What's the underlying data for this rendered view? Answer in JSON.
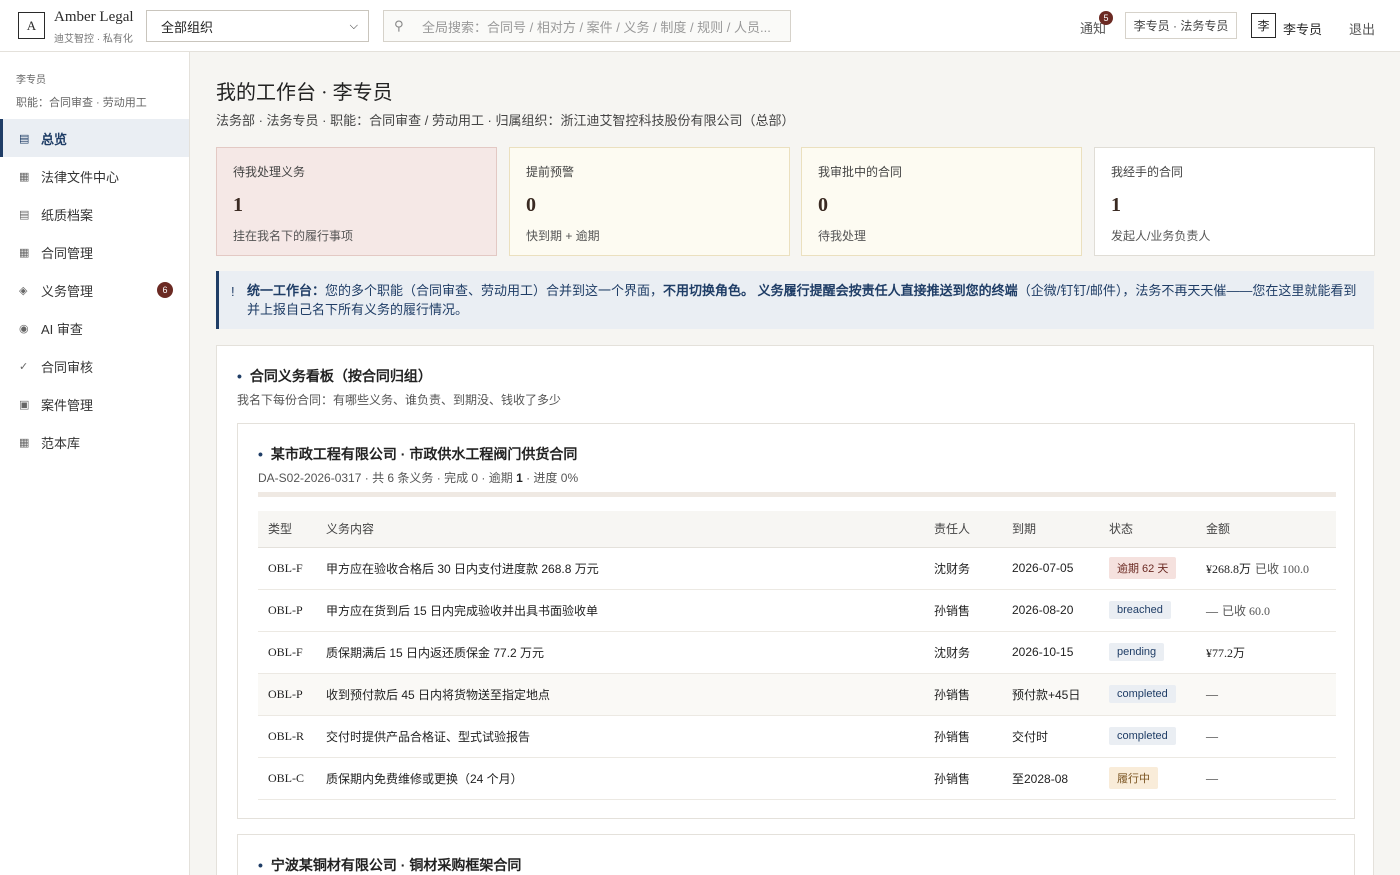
{
  "topbar": {
    "logo_letter": "A",
    "brand_name": "Amber Legal",
    "brand_sub": "迪艾智控 · 私有化",
    "org_select": "全部组织",
    "search_placeholder": "全局搜索：合同号 / 相对方 / 案件 / 义务 / 制度 / 规则 / 人员...",
    "notice_label": "通知",
    "notice_count": "5",
    "role_chip": "李专员 · 法务专员",
    "avatar_char": "李",
    "username": "李专员",
    "logout": "退出"
  },
  "sidebar": {
    "user": "李专员",
    "functions": "职能：合同审查 · 劳动用工",
    "items": [
      {
        "label": "总览",
        "icon": "list-icon",
        "glyph": "▤",
        "active": true
      },
      {
        "label": "法律文件中心",
        "icon": "grid-icon",
        "glyph": "▦"
      },
      {
        "label": "纸质档案",
        "icon": "archive-icon",
        "glyph": "▤"
      },
      {
        "label": "合同管理",
        "icon": "grid-icon",
        "glyph": "▦"
      },
      {
        "label": "义务管理",
        "icon": "diamond-icon",
        "glyph": "◈",
        "badge": "6"
      },
      {
        "label": "AI 审查",
        "icon": "target-icon",
        "glyph": "◉"
      },
      {
        "label": "合同审核",
        "icon": "check-icon",
        "glyph": "✓"
      },
      {
        "label": "案件管理",
        "icon": "square-icon",
        "glyph": "▣"
      },
      {
        "label": "范本库",
        "icon": "grid-icon",
        "glyph": "▦"
      }
    ]
  },
  "page": {
    "title": "我的工作台 · 李专员",
    "subtitle": "法务部 · 法务专员 · 职能：合同审查 / 劳动用工 · 归属组织：浙江迪艾智控科技股份有限公司（总部）"
  },
  "stats": [
    {
      "label": "待我处理义务",
      "value": "1",
      "note": "挂在我名下的履行事项"
    },
    {
      "label": "提前预警",
      "value": "0",
      "note": "快到期 + 逾期"
    },
    {
      "label": "我审批中的合同",
      "value": "0",
      "note": "待我处理"
    },
    {
      "label": "我经手的合同",
      "value": "1",
      "note": "发起人/业务负责人"
    }
  ],
  "banner": {
    "mark": "!",
    "lead": "统一工作台：",
    "text1": "您的多个职能（合同审查、劳动用工）合并到这一个界面，",
    "bold1": "不用切换角色。",
    "bold2": "义务履行提醒会按责任人直接推送到您的终端",
    "text2": "（企微/钉钉/邮件），法务不再天天催——您在这里就能看到并上报自己名下所有义务的履行情况。"
  },
  "board": {
    "title": "合同义务看板（按合同归组）",
    "subtitle": "我名下每份合同：有哪些义务、谁负责、到期没、钱收了多少",
    "columns": [
      "类型",
      "义务内容",
      "责任人",
      "到期",
      "状态",
      "金额"
    ],
    "contracts": [
      {
        "title": "某市政工程有限公司 · 市政供水工程阀门供货合同",
        "meta_prefix": "DA-S02-2026-0317 · 共 6 条义务 · 完成 0 · 逾期 ",
        "overdue": "1",
        "meta_suffix": " · 进度 0%",
        "progress": 0,
        "rows": [
          {
            "type": "OBL-F",
            "content": "甲方应在验收合格后 30 日内支付进度款 268.8 万元",
            "owner": "沈财务",
            "due": "2026-07-05",
            "status": "逾期 62 天",
            "status_kind": "overdue",
            "amount": "¥268.8万",
            "received": "已收 100.0"
          },
          {
            "type": "OBL-P",
            "content": "甲方应在货到后 15 日内完成验收并出具书面验收单",
            "owner": "孙销售",
            "due": "2026-08-20",
            "status": "breached",
            "status_kind": "breached",
            "amount": "—",
            "received": "已收 60.0"
          },
          {
            "type": "OBL-F",
            "content": "质保期满后 15 日内返还质保金 77.2 万元",
            "owner": "沈财务",
            "due": "2026-10-15",
            "status": "pending",
            "status_kind": "pending",
            "amount": "¥77.2万",
            "received": ""
          },
          {
            "type": "OBL-P",
            "content": "收到预付款后 45 日内将货物送至指定地点",
            "owner": "孙销售",
            "due": "预付款+45日",
            "status": "completed",
            "status_kind": "completed",
            "amount": "—",
            "received": ""
          },
          {
            "type": "OBL-R",
            "content": "交付时提供产品合格证、型式试验报告",
            "owner": "孙销售",
            "due": "交付时",
            "status": "completed",
            "status_kind": "completed",
            "amount": "—",
            "received": ""
          },
          {
            "type": "OBL-C",
            "content": "质保期内免费维修或更换（24 个月）",
            "owner": "孙销售",
            "due": "至2028-08",
            "status": "履行中",
            "status_kind": "inprogress",
            "amount": "—",
            "received": ""
          }
        ]
      },
      {
        "title": "宁波某铜材有限公司 · 铜材采购框架合同"
      }
    ]
  }
}
